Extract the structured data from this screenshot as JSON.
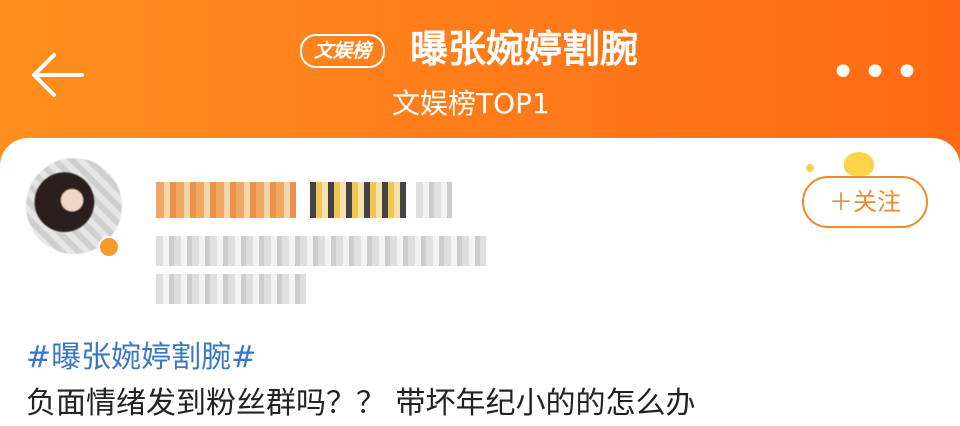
{
  "header": {
    "badge": "文娱榜",
    "title": "曝张婉婷割腕",
    "subtitle": "文娱榜TOP1",
    "more": "•••"
  },
  "post": {
    "follow_label": "＋关注",
    "hashtag": "#曝张婉婷割腕#",
    "text": "负面情绪发到粉丝群吗？？ 带坏年纪小的的怎么办"
  },
  "colors": {
    "header_orange": "#ff7a1a",
    "link_blue": "#3a79c2",
    "follow_orange": "#f08a2a"
  },
  "icons": {
    "back": "back-arrow-icon",
    "more": "more-icon"
  }
}
